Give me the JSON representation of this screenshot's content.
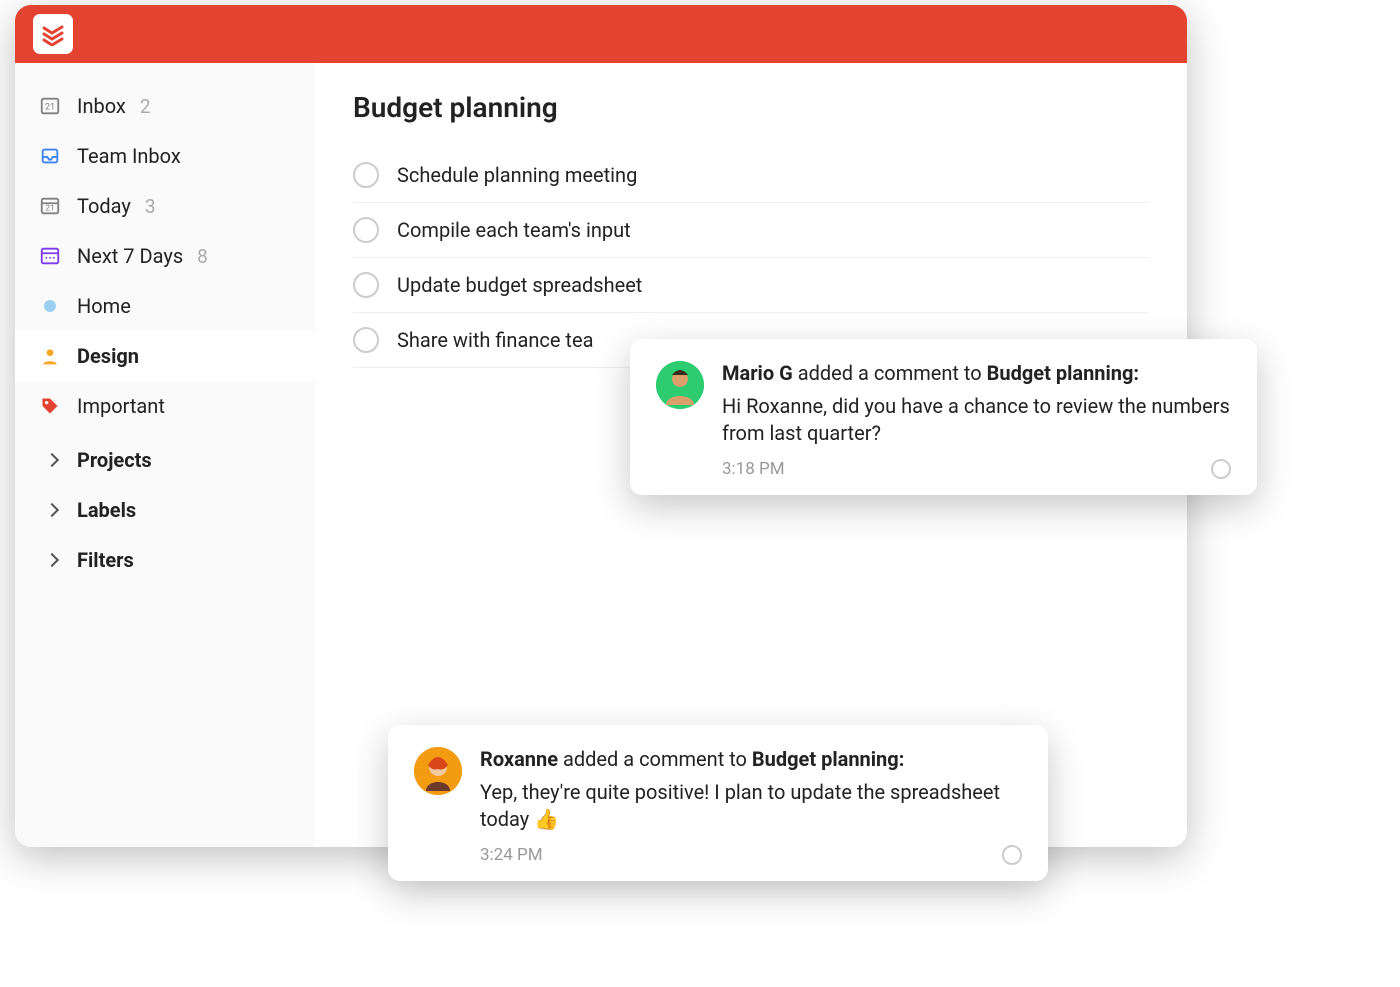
{
  "sidebar": {
    "items": [
      {
        "label": "Inbox",
        "count": "2",
        "icon": "inbox"
      },
      {
        "label": "Team Inbox",
        "count": "",
        "icon": "team-inbox"
      },
      {
        "label": "Today",
        "count": "3",
        "icon": "today"
      },
      {
        "label": "Next 7 Days",
        "count": "8",
        "icon": "next7"
      },
      {
        "label": "Home",
        "count": "",
        "icon": "dot-blue"
      },
      {
        "label": "Design",
        "count": "",
        "icon": "person-yellow"
      },
      {
        "label": "Important",
        "count": "",
        "icon": "tag-red"
      }
    ],
    "sections": [
      {
        "label": "Projects"
      },
      {
        "label": "Labels"
      },
      {
        "label": "Filters"
      }
    ]
  },
  "main": {
    "title": "Budget planning",
    "tasks": [
      "Schedule planning meeting",
      "Compile each team's input",
      "Update budget spreadsheet",
      "Share with finance tea"
    ]
  },
  "notifications": [
    {
      "author": "Mario G",
      "action_mid": " added a comment to ",
      "target": "Budget planning:",
      "message": "Hi Roxanne, did you have a chance to review the numbers from last quarter?",
      "time": "3:18 PM"
    },
    {
      "author": "Roxanne",
      "action_mid": " added a comment to ",
      "target": "Budget planning:",
      "message": "Yep, they're quite positive! I plan to update the spreadsheet today 👍",
      "time": "3:24 PM"
    }
  ]
}
